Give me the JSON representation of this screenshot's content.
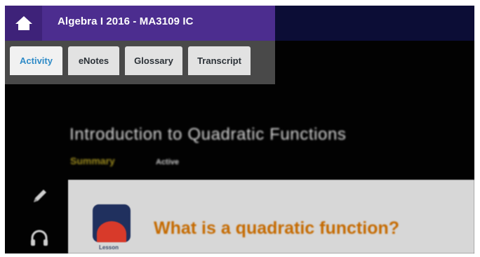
{
  "header": {
    "course_title": "Algebra I 2016 - MA3109 IC",
    "home_icon": "home-icon"
  },
  "tabs": [
    {
      "label": "Activity",
      "active": true
    },
    {
      "label": "eNotes",
      "active": false
    },
    {
      "label": "Glossary",
      "active": false
    },
    {
      "label": "Transcript",
      "active": false
    }
  ],
  "lesson": {
    "title": "Introduction to Quadratic Functions",
    "summary_label": "Summary",
    "status_label": "Active"
  },
  "sidebar": {
    "icons": [
      "pencil-icon",
      "headphones-icon"
    ]
  },
  "card": {
    "question": "What is a quadratic function?",
    "icon_label": "Lesson"
  },
  "colors": {
    "header_purple": "#4c2d8f",
    "tab_active_text": "#2f8bc7",
    "summary_gold": "#9b8a1f",
    "question_orange": "#c56a00",
    "lesson_icon_red": "#d83a2a"
  }
}
